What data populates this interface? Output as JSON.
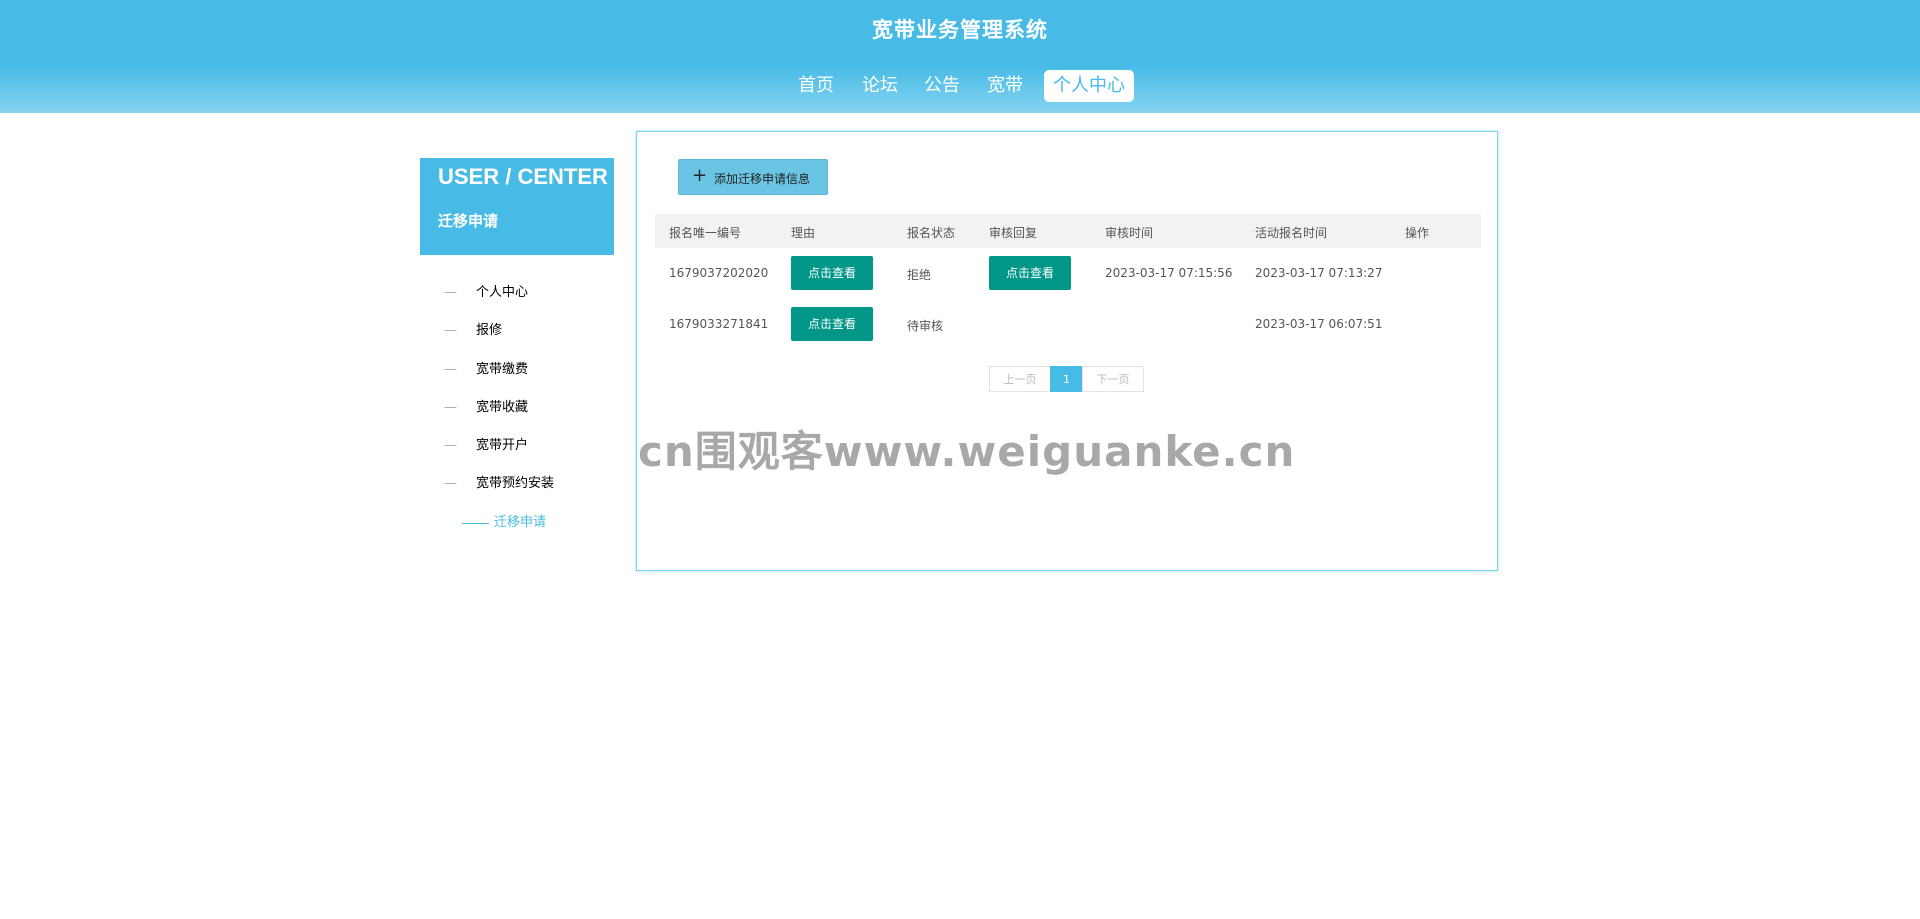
{
  "header": {
    "title": "宽带业务管理系统",
    "nav": [
      "首页",
      "论坛",
      "公告",
      "宽带",
      "个人中心"
    ],
    "active_nav": "个人中心"
  },
  "sidebar": {
    "heading": "USER / CENTER",
    "subheading": "迁移申请",
    "items": [
      {
        "label": "个人中心"
      },
      {
        "label": "报修"
      },
      {
        "label": "宽带缴费"
      },
      {
        "label": "宽带收藏"
      },
      {
        "label": "宽带开户"
      },
      {
        "label": "宽带预约安装"
      },
      {
        "label": "迁移申请",
        "active": true
      }
    ]
  },
  "toolbar": {
    "add_icon": "plus-icon",
    "add_label": "添加迁移申请信息"
  },
  "table": {
    "headers": [
      "报名唯一编号",
      "理由",
      "报名状态",
      "审核回复",
      "审核时间",
      "活动报名时间",
      "操作"
    ],
    "view_label": "点击查看",
    "rows": [
      {
        "id": "1679037202020",
        "status": "拒绝",
        "review_time": "2023-03-17 07:15:56",
        "signup_time": "2023-03-17 07:13:27",
        "has_reply": true
      },
      {
        "id": "1679033271841",
        "status": "待审核",
        "review_time": "",
        "signup_time": "2023-03-17 06:07:51",
        "has_reply": false
      }
    ]
  },
  "pagination": {
    "prev": "上一页",
    "current": "1",
    "next": "下一页"
  },
  "watermark": "cn围观客www.weiguanke.cn",
  "colors": {
    "primary": "#47bbe6",
    "button": "#009688"
  }
}
